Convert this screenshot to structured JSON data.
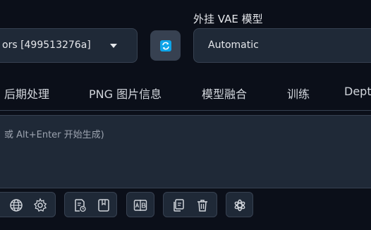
{
  "top": {
    "model_select": {
      "value": "ors [499513276a]"
    },
    "vae": {
      "label": "外挂 VAE 模型",
      "value": "Automatic"
    }
  },
  "tabs": [
    {
      "label": "后期处理"
    },
    {
      "label": "PNG 图片信息"
    },
    {
      "label": "模型融合"
    },
    {
      "label": "训练"
    },
    {
      "label": "Dept"
    }
  ],
  "prompt": {
    "placeholder": "或 Alt+Enter 开始生成)"
  },
  "toolbar": {
    "icons": [
      "globe-icon",
      "gear-icon",
      "document-clock-icon",
      "bookmark-icon",
      "text-compare-icon",
      "copy-icon",
      "trash-icon",
      "openai-icon"
    ]
  },
  "colors": {
    "background": "#0b0f19",
    "panel": "#1f2937",
    "accent": "#0ea5e9"
  }
}
